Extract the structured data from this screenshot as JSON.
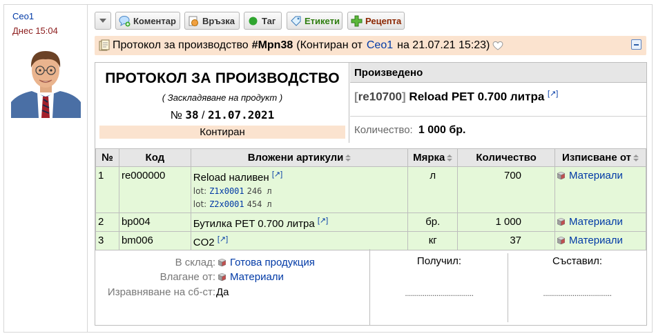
{
  "author": {
    "name": "Ceo1",
    "time": "Днес 15:04"
  },
  "toolbar": {
    "buttons": [
      {
        "label": "Коментар"
      },
      {
        "label": "Връзка"
      },
      {
        "label": "Таг"
      },
      {
        "label": "Етикети"
      },
      {
        "label": "Рецепта"
      }
    ]
  },
  "docbar": {
    "prefix": "Протокол за производство",
    "number": "#Mpn38",
    "contirated_by": "(Контиран от",
    "user": "Ceo1",
    "on_date": "на 21.07.21 15:23)"
  },
  "header": {
    "title": "ПРОТОКОЛ ЗА ПРОИЗВОДСТВО",
    "subtitle": "( Заскладяване на продукт )",
    "num_label": "№",
    "num": "38",
    "sep": "/",
    "date": "21.07.2021",
    "status": "Контиран"
  },
  "produced": {
    "heading": "Произведено",
    "code": "re10700",
    "name": "Reload PET 0.700 литра",
    "ext": "[↗]",
    "qty_label": "Количество:",
    "qty_value": "1 000 бр."
  },
  "table": {
    "columns": [
      "№",
      "Код",
      "Вложени артикули",
      "Мярка",
      "Количество",
      "Изписване от"
    ],
    "rows": [
      {
        "n": "1",
        "code": "re000000",
        "name": "Reload наливен",
        "ext": "[↗]",
        "lots": [
          {
            "label": "lot:",
            "code": "Z1x0001",
            "qty": "246 л"
          },
          {
            "label": "lot:",
            "code": "Z2x0001",
            "qty": "454 л"
          }
        ],
        "unit": "л",
        "qty": "700",
        "from": "Материали"
      },
      {
        "n": "2",
        "code": "bp004",
        "name": "Бутилка PET 0.700 литра",
        "ext": "[↗]",
        "unit": "бр.",
        "qty": "1 000",
        "from": "Материали"
      },
      {
        "n": "3",
        "code": "bm006",
        "name": "CO2",
        "ext": "[↗]",
        "unit": "кг",
        "qty": "37",
        "from": "Материали"
      }
    ]
  },
  "footer": {
    "store_label": "В склад:",
    "store_value": "Готова продукция",
    "input_label": "Влагане от:",
    "input_value": "Материали",
    "adjust_label": "Изравняване на сб-ст:",
    "adjust_value": "Да",
    "received_label": "Получил:",
    "received_dots": "...................................",
    "composed_label": "Съставил:",
    "composed_dots": "..................................."
  }
}
